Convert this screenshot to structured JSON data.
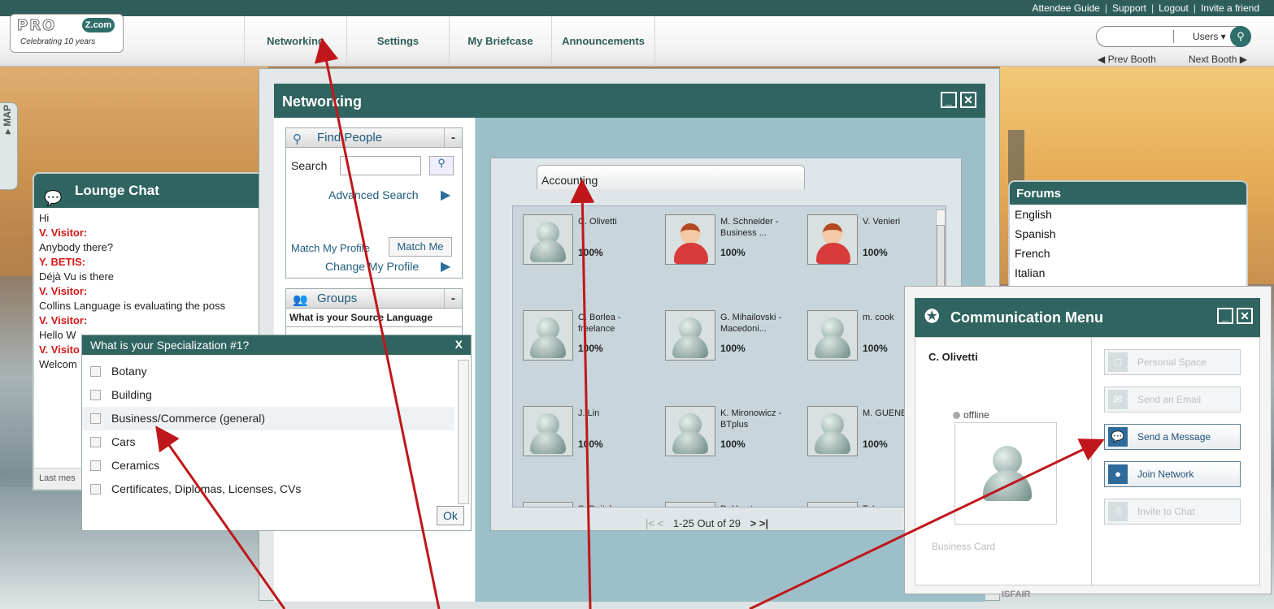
{
  "top_links": [
    "Attendee Guide",
    "Support",
    "Logout",
    "Invite a friend"
  ],
  "logo": {
    "tagline": "Celebrating 10 years",
    "brand": "PRO",
    "brand_badge": "Z.com"
  },
  "nav": [
    "Networking",
    "Settings",
    "My Briefcase",
    "Announcements"
  ],
  "search": {
    "users_label": "Users ▾",
    "placeholder": ""
  },
  "booth": {
    "prev": "◀ Prev Booth",
    "next": "Next Booth ▶"
  },
  "map_tab": "▸ MAP",
  "lounge": {
    "title": "Lounge Chat",
    "messages": [
      {
        "type": "text",
        "text": "Hi"
      },
      {
        "type": "who",
        "text": "V. Visitor:"
      },
      {
        "type": "text",
        "text": "Anybody there?"
      },
      {
        "type": "who",
        "text": "Y. BETIS:"
      },
      {
        "type": "text",
        "text": "Déjà Vu is there"
      },
      {
        "type": "who",
        "text": "V. Visitor:"
      },
      {
        "type": "text",
        "text": "Collins Language is evaluating the poss"
      },
      {
        "type": "who",
        "text": "V. Visitor:"
      },
      {
        "type": "text",
        "text": "Hello W"
      },
      {
        "type": "who",
        "text": "V. Visito"
      },
      {
        "type": "text",
        "text": "Welcom"
      }
    ],
    "footer": "Last mes"
  },
  "networking": {
    "title": "Networking",
    "find_people": {
      "title": "Find People",
      "search_label": "Search",
      "advanced": "Advanced Search",
      "match_profile": "Match My Profile",
      "match_me": "Match Me",
      "change_profile": "Change My Profile"
    },
    "groups": {
      "title": "Groups",
      "question": "What is your Source Language"
    },
    "tab": "Accounting",
    "people": [
      {
        "name": "C. Olivetti",
        "pct": "100%",
        "g": "m"
      },
      {
        "name": "M. Schneider - Business ...",
        "pct": "100%",
        "g": "f"
      },
      {
        "name": "V. Venieri",
        "pct": "100%",
        "g": "f"
      },
      {
        "name": "C. Borlea - freelance",
        "pct": "100%",
        "g": "m"
      },
      {
        "name": "G. Mihailovski - Macedoni...",
        "pct": "100%",
        "g": "m"
      },
      {
        "name": "m. cook",
        "pct": "100%",
        "g": "m"
      },
      {
        "name": "J. Lin",
        "pct": "100%",
        "g": "m"
      },
      {
        "name": "K. Mironowicz - BTplus",
        "pct": "100%",
        "g": "m"
      },
      {
        "name": "M. GUENET",
        "pct": "100%",
        "g": "m"
      },
      {
        "name": "S. Daitch -",
        "pct": "",
        "g": "m"
      },
      {
        "name": "D. Hrastovec -",
        "pct": "",
        "g": "m"
      },
      {
        "name": "T. Ivanov",
        "pct": "",
        "g": "m"
      }
    ],
    "pager": "1-25 Out of 29"
  },
  "specialization": {
    "title": "What is your Specialization #1?",
    "close": "X",
    "items": [
      "Botany",
      "Building",
      "Business/Commerce (general)",
      "Cars",
      "Ceramics",
      "Certificates, Diplomas, Licenses, CVs"
    ],
    "ok": "Ok"
  },
  "forums": {
    "title": "Forums",
    "items": [
      "English",
      "Spanish",
      "French",
      "Italian"
    ]
  },
  "comm": {
    "title": "Communication Menu",
    "name": "C. Olivetti",
    "status": "offline",
    "business_card": "Business Card",
    "buttons": [
      {
        "label": "Personal Space",
        "enabled": false
      },
      {
        "label": "Send an Email",
        "enabled": false
      },
      {
        "label": "Send a Message",
        "enabled": true
      },
      {
        "label": "Join Network",
        "enabled": true
      },
      {
        "label": "Invite to Chat",
        "enabled": false
      }
    ]
  },
  "bottom_stub": "ISFAIR",
  "colors": {
    "header": "#2f6460",
    "accent": "#2f6b9a",
    "alert": "#d41818",
    "arrow": "#c0161b"
  }
}
